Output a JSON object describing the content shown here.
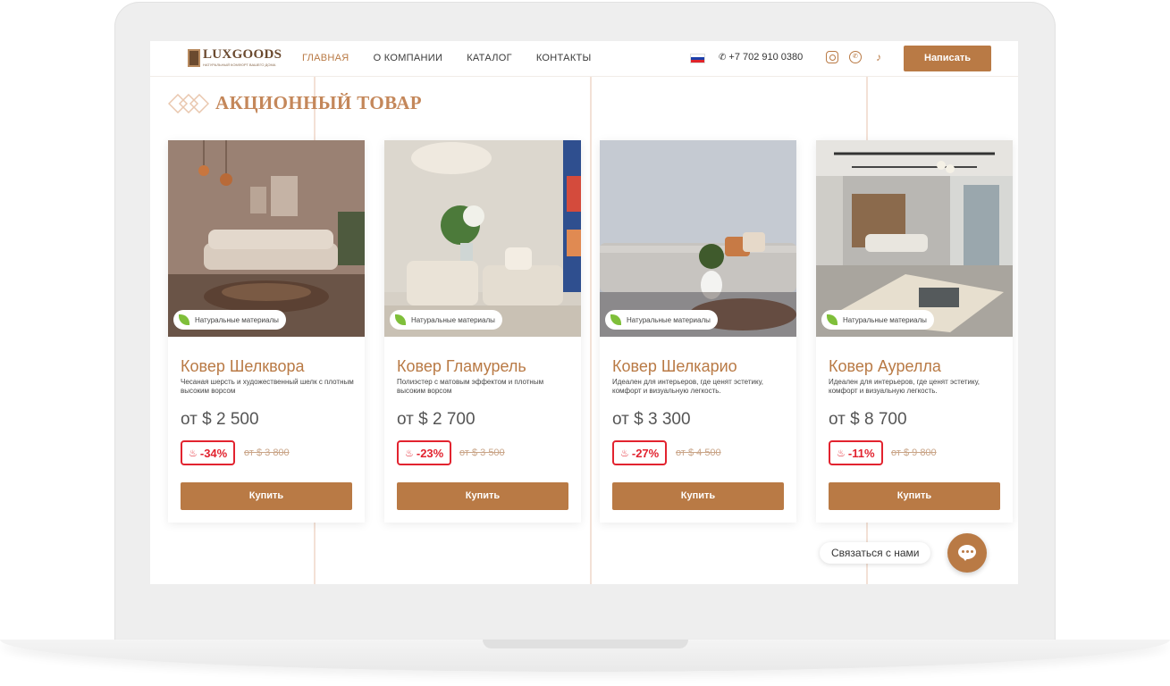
{
  "header": {
    "logo_text": "LUXGOODS",
    "logo_subtitle": "НАТУРАЛЬНЫЙ КОМФОРТ ВАШЕГО ДОМА",
    "nav": [
      {
        "label": "ГЛАВНАЯ",
        "active": true
      },
      {
        "label": "О КОМПАНИИ",
        "active": false
      },
      {
        "label": "КАТАЛОГ",
        "active": false
      },
      {
        "label": "КОНТАКТЫ",
        "active": false
      }
    ],
    "language": "ru",
    "phone": "+7 702 910 0380",
    "social_icons": [
      "instagram-icon",
      "whatsapp-icon",
      "tiktok-icon"
    ],
    "write_button": "Написать"
  },
  "section": {
    "title": "АКЦИОННЫЙ ТОВАР"
  },
  "products": [
    {
      "badge": "Натуральные материалы",
      "name": "Ковер Шелквора",
      "description": "Чесаная шерсть и художественный шелк с плотным высоким ворсом",
      "price": "от $ 2 500",
      "discount": "-34%",
      "old_price": "от $ 3 800",
      "buy": "Купить"
    },
    {
      "badge": "Натуральные материалы",
      "name": "Ковер Гламурель",
      "description": "Полиэстер с матовым эффектом и плотным высоким ворсом",
      "price": "от $ 2 700",
      "discount": "-23%",
      "old_price": "от $ 3 500",
      "buy": "Купить"
    },
    {
      "badge": "Натуральные материалы",
      "name": "Ковер Шелкарио",
      "description": "Идеален для интерьеров, где ценят эстетику, комфорт и визуальную легкость.",
      "price": "от $ 3 300",
      "discount": "-27%",
      "old_price": "от $ 4 500",
      "buy": "Купить"
    },
    {
      "badge": "Натуральные материалы",
      "name": "Ковер Аурелла",
      "description": "Идеален для интерьеров, где ценят эстетику, комфорт и визуальную легкость.",
      "price": "от $ 8 700",
      "discount": "-11%",
      "old_price": "от $ 9 800",
      "buy": "Купить"
    }
  ],
  "contact_widget": {
    "label": "Связаться с нами"
  },
  "colors": {
    "accent": "#b97a45",
    "discount_red": "#e2232f",
    "leaf_green": "#7fbf3a"
  }
}
